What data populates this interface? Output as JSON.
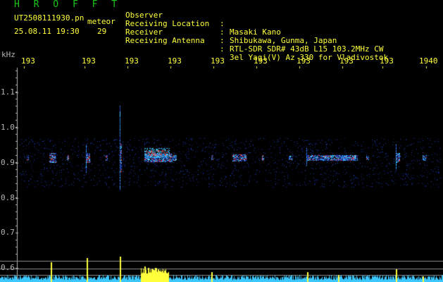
{
  "header": {
    "brand": "H R O F F T",
    "filename": "UT2508111930.pn",
    "tag": "meteor",
    "datetime": "25.08.11 19:30",
    "count": "29"
  },
  "info": [
    {
      "label": "Observer",
      "value": "Masaki Kano"
    },
    {
      "label": "Receiving Location",
      "value": "Shibukawa, Gunma, Japan"
    },
    {
      "label": "Receiver",
      "value": "RTL-SDR SDR# 43dB L15 103.2MHz CW"
    },
    {
      "label": "Receiving Antenna",
      "value": "3el Yagi(V) Az 330 for Vladivostok"
    }
  ],
  "info_separator": ":",
  "axis": {
    "y_unit": "kHz",
    "y_ticks": [
      "1.1",
      "1.0",
      "0.9",
      "0.8",
      "0.7",
      "0.6"
    ],
    "x_ticks": [
      "193",
      "193",
      "193",
      "193",
      "193",
      "193",
      "193",
      "193",
      "193",
      "1940"
    ]
  },
  "colors": {
    "background": "#000000",
    "brand": "#19c819",
    "text": "#ffff3c",
    "axis": "#b4b4b4",
    "signal_hot": "#ff3c3c",
    "signal_mid": "#3cc8ff",
    "signal_low": "#1e3cb4"
  }
}
